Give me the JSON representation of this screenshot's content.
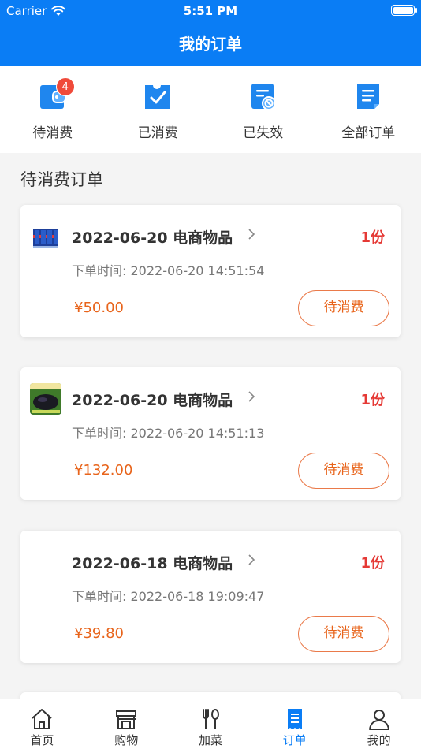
{
  "status_bar": {
    "carrier": "Carrier",
    "time": "5:51 PM"
  },
  "header": {
    "title": "我的订单"
  },
  "quick_tabs": [
    {
      "label": "待消费",
      "icon": "wallet-icon",
      "badge": "4"
    },
    {
      "label": "已消费",
      "icon": "check-card-icon"
    },
    {
      "label": "已失效",
      "icon": "invalid-doc-icon"
    },
    {
      "label": "全部订单",
      "icon": "list-doc-icon"
    }
  ],
  "section_title": "待消费订单",
  "orders": [
    {
      "title": "2022-06-20 电商物品",
      "quantity": "1份",
      "order_time": "下单时间: 2022-06-20 14:51:54",
      "price": "¥50.00",
      "action": "待消费",
      "thumbnail": "soda-cans-thumbnail"
    },
    {
      "title": "2022-06-20 电商物品",
      "quantity": "1份",
      "order_time": "下单时间: 2022-06-20 14:51:13",
      "price": "¥132.00",
      "action": "待消费",
      "thumbnail": "black-rice-thumbnail"
    },
    {
      "title": "2022-06-18 电商物品",
      "quantity": "1份",
      "order_time": "下单时间: 2022-06-18 19:09:47",
      "price": "¥39.80",
      "action": "待消费",
      "thumbnail": ""
    }
  ],
  "tabbar": [
    {
      "label": "首页",
      "icon": "home-icon",
      "active": false
    },
    {
      "label": "购物",
      "icon": "store-icon",
      "active": false
    },
    {
      "label": "加菜",
      "icon": "fork-spoon-icon",
      "active": false
    },
    {
      "label": "订单",
      "icon": "order-doc-icon",
      "active": true
    },
    {
      "label": "我的",
      "icon": "user-icon",
      "active": false
    }
  ],
  "colors": {
    "brand": "#0a7df5",
    "price": "#e8641b",
    "quantity": "#e53935",
    "badge": "#f04a3a"
  }
}
